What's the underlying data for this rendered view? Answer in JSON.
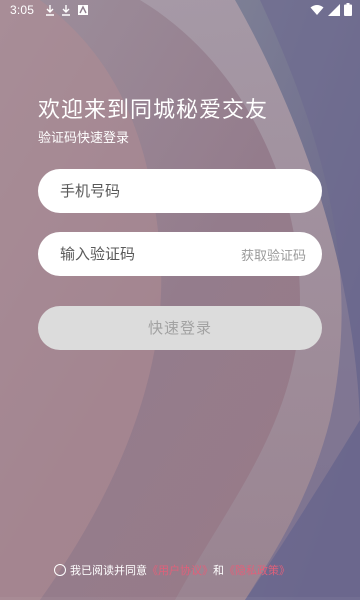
{
  "status_bar": {
    "time": "3:05",
    "icons": [
      "download-icon",
      "download-icon",
      "app-icon",
      "wifi-icon",
      "signal-icon",
      "battery-icon"
    ]
  },
  "header": {
    "title": "欢迎来到同城秘爱交友",
    "subtitle": "验证码快速登录"
  },
  "form": {
    "phone_placeholder": "手机号码",
    "code_placeholder": "输入验证码",
    "get_code_label": "获取验证码",
    "login_label": "快速登录"
  },
  "agreement": {
    "prefix": "我已阅读并同意",
    "user_agreement": "《用户协议》",
    "conjunction": "和",
    "privacy_policy": "《隐私政策》"
  },
  "colors": {
    "link": "#e0607a",
    "button_bg": "#dcdcdc",
    "button_text": "#a2a2a2",
    "placeholder": "#5a5a5a",
    "get_code_text": "#9a9a9a"
  }
}
